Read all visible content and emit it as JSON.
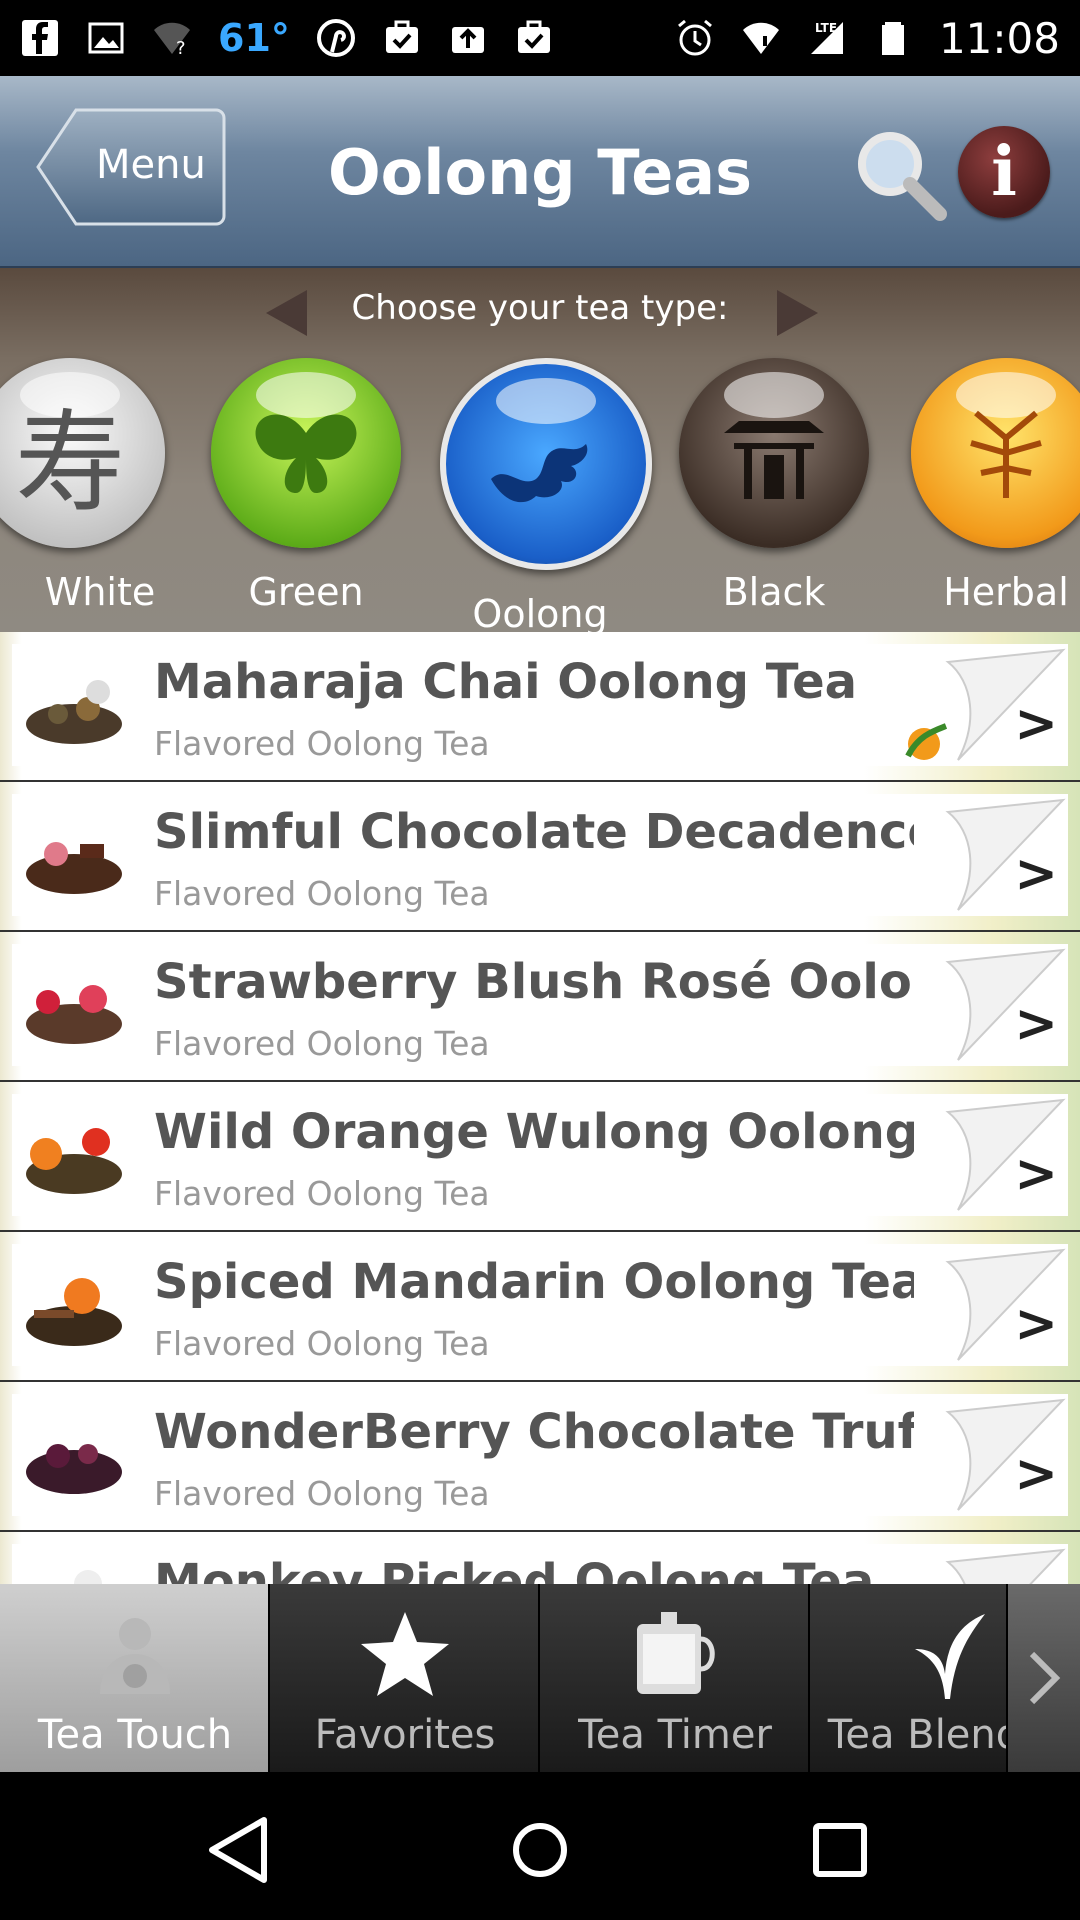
{
  "status_bar": {
    "temperature": "61°",
    "time": "11:08",
    "network": "LTE"
  },
  "header": {
    "menu_label": "Menu",
    "title": "Oolong Teas"
  },
  "chooser": {
    "label": "Choose your tea type:",
    "types": [
      {
        "label": "White",
        "color": "#d8d8d8",
        "glyph": "寿"
      },
      {
        "label": "Green",
        "color": "#7ccf2a",
        "glyph": "butterfly"
      },
      {
        "label": "Oolong",
        "color": "#1f6fd6",
        "glyph": "dragon",
        "selected": true
      },
      {
        "label": "Black",
        "color": "#4a3a30",
        "glyph": "pagoda"
      },
      {
        "label": "Herbal",
        "color": "#f4a21c",
        "glyph": "flower"
      }
    ]
  },
  "teas": [
    {
      "name": "Maharaja Chai Oolong Tea",
      "sub": "Flavored Oolong Tea",
      "badge": true
    },
    {
      "name": "Slimful Chocolate Decadence…",
      "sub": "Flavored Oolong Tea"
    },
    {
      "name": "Strawberry Blush Rosé Oolon…",
      "sub": "Flavored Oolong Tea"
    },
    {
      "name": "Wild Orange Wulong Oolong T…",
      "sub": "Flavored Oolong Tea"
    },
    {
      "name": "Spiced Mandarin Oolong Tea",
      "sub": "Flavored Oolong Tea"
    },
    {
      "name": "WonderBerry Chocolate Truffl…",
      "sub": "Flavored Oolong Tea"
    },
    {
      "name": "Monkey Picked Oolong Tea",
      "sub": ""
    }
  ],
  "tabs": [
    {
      "label": "Tea Touch",
      "icon": "tea-touch-icon",
      "active": true
    },
    {
      "label": "Favorites",
      "icon": "star-icon"
    },
    {
      "label": "Tea Timer",
      "icon": "tea-timer-icon"
    },
    {
      "label": "Tea Blender",
      "icon": "tea-leaf-icon"
    }
  ]
}
